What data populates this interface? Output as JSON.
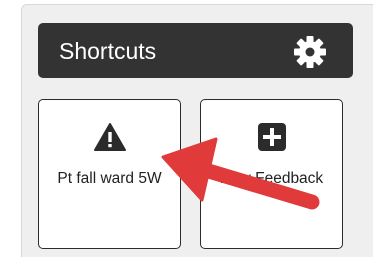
{
  "header": {
    "title": "Shortcuts",
    "settings_icon": "gear-icon"
  },
  "shortcuts": [
    {
      "label": "Pt fall ward 5W",
      "icon": "warning-triangle-icon"
    },
    {
      "label": "New Feedback",
      "icon": "plus-square-icon"
    }
  ],
  "annotation": {
    "icon": "red-arrow",
    "color": "#e03a3a"
  },
  "colors": {
    "header_bg": "#333333",
    "panel_bg": "#efefef",
    "tile_bg": "#ffffff"
  }
}
